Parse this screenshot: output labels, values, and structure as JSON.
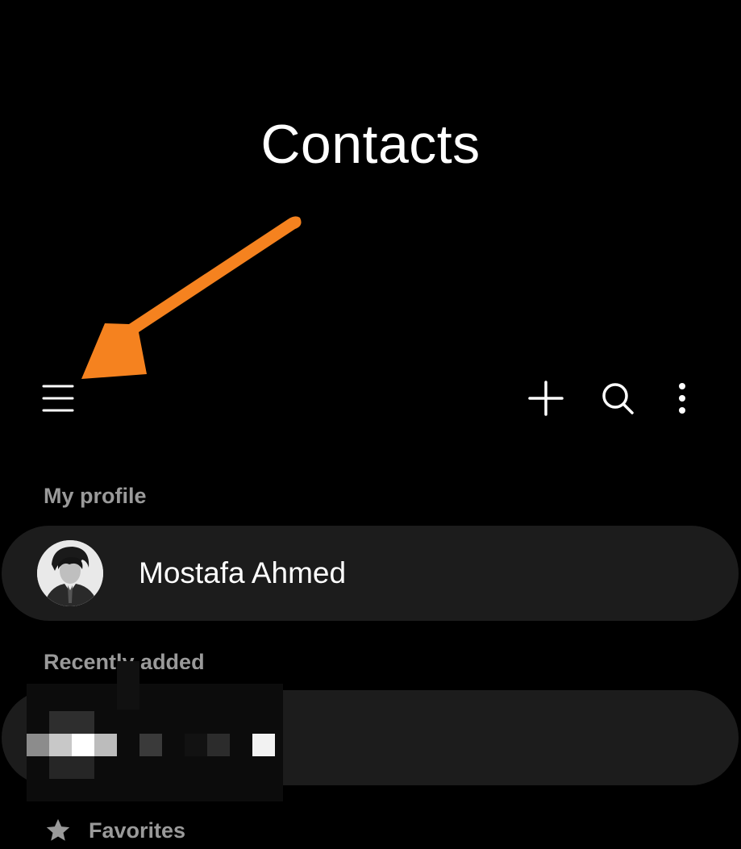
{
  "header": {
    "title": "Contacts"
  },
  "toolbar": {
    "menu_icon": "hamburger-menu-icon",
    "add_icon": "plus-icon",
    "search_icon": "search-icon",
    "more_icon": "more-vertical-icon"
  },
  "annotation": {
    "arrow_color": "#F5821F"
  },
  "profile_section": {
    "label": "My profile",
    "name": "Mostafa Ahmed"
  },
  "recent_section": {
    "label": "Recently added"
  },
  "favorites_section": {
    "label": "Favorites",
    "icon": "star-icon"
  },
  "colors": {
    "background": "#000000",
    "card": "#1c1c1c",
    "section_label": "#9a9a9a",
    "text": "#ffffff"
  }
}
